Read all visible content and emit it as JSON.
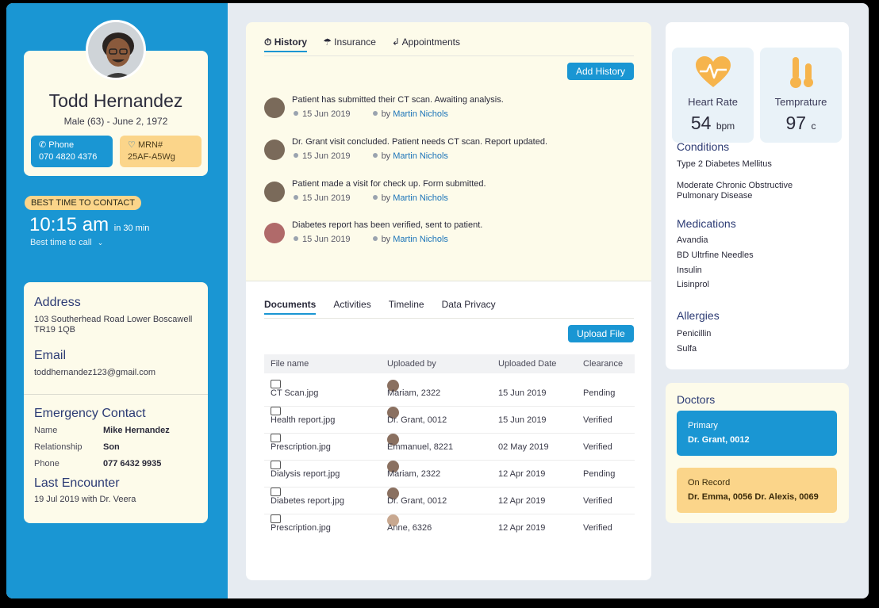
{
  "patient": {
    "name": "Todd Hernandez",
    "details": "Male (63) - June 2, 1972",
    "phone_label": "Phone",
    "phone": "070 4820 4376",
    "mrn_label": "MRN#",
    "mrn": "25AF-A5Wg"
  },
  "contact_time": {
    "badge": "BEST TIME TO CONTACT",
    "time": "10:15 am",
    "relative": "in 30 min",
    "sub": "Best time to call"
  },
  "contact": {
    "address_title": "Address",
    "address": "103  Southerhead Road Lower Boscawell TR19 1QB",
    "email_title": "Email",
    "email": "toddhernandez123@gmail.com",
    "emergency_title": "Emergency Contact",
    "emergency": [
      {
        "key": "Name",
        "value": "Mike Hernandez"
      },
      {
        "key": "Relationship",
        "value": "Son"
      },
      {
        "key": "Phone",
        "value": "077 6432 9935"
      }
    ],
    "last_encounter_title": "Last Encounter",
    "last_encounter": "19 Jul 2019 with Dr. Veera"
  },
  "history": {
    "tabs": [
      "History",
      "Insurance",
      "Appointments"
    ],
    "add_button": "Add History",
    "by_label": "by",
    "items": [
      {
        "text": "Patient has submitted their CT scan. Awaiting analysis.",
        "date": "15 Jun 2019",
        "author": "Martin Nichols"
      },
      {
        "text": "Dr. Grant visit concluded. Patient needs CT scan. Report updated.",
        "date": "15 Jun 2019",
        "author": "Martin Nichols"
      },
      {
        "text": "Patient made a visit for check up. Form submitted.",
        "date": "15 Jun 2019",
        "author": "Martin Nichols"
      },
      {
        "text": "Diabetes report has been verified, sent to patient.",
        "date": "15 Jun 2019",
        "author": "Martin Nichols"
      }
    ]
  },
  "documents": {
    "tabs": [
      "Documents",
      "Activities",
      "Timeline",
      "Data Privacy"
    ],
    "upload_button": "Upload  File",
    "columns": [
      "File name",
      "Uploaded by",
      "Uploaded Date",
      "Clearance"
    ],
    "rows": [
      {
        "file": "CT Scan.jpg",
        "by": "Mariam, 2322",
        "date": "15 Jun 2019",
        "clearance": "Pending"
      },
      {
        "file": "Health report.jpg",
        "by": "Dr. Grant, 0012",
        "date": "15 Jun 2019",
        "clearance": "Verified"
      },
      {
        "file": "Prescription.jpg",
        "by": "Emmanuel, 8221",
        "date": "02 May 2019",
        "clearance": "Verified"
      },
      {
        "file": "Dialysis report.jpg",
        "by": "Mariam, 2322",
        "date": "12 Apr 2019",
        "clearance": "Pending"
      },
      {
        "file": "Diabetes report.jpg",
        "by": "Dr. Grant, 0012",
        "date": "12 Apr 2019",
        "clearance": "Verified"
      },
      {
        "file": "Prescription.jpg",
        "by": "Anne, 6326",
        "date": "12 Apr 2019",
        "clearance": "Verified"
      }
    ]
  },
  "vitals": {
    "heart_rate_label": "Heart Rate",
    "heart_rate_value": "54",
    "heart_rate_unit": "bpm",
    "temperature_label": "Temprature",
    "temperature_value": "97",
    "temperature_unit": "c"
  },
  "conditions": {
    "title": "Conditions",
    "items": [
      "Type 2 Diabetes Mellitus",
      "Moderate Chronic Obstructive Pulmonary Disease"
    ]
  },
  "medications": {
    "title": "Medications",
    "items": [
      "Avandia",
      "BD Ultrfine Needles",
      "Insulin",
      "Lisinprol"
    ]
  },
  "allergies": {
    "title": "Allergies",
    "items": [
      "Penicillin",
      "Sulfa"
    ]
  },
  "doctors": {
    "title": "Doctors",
    "primary_label": "Primary",
    "primary": "Dr. Grant, 0012",
    "record_label": "On Record",
    "record": "Dr. Emma, 0056 Dr. Alexis, 0069"
  },
  "colors": {
    "accent_blue": "#1a96d3",
    "accent_yellow": "#fbd58a",
    "heading_navy": "#2c3b74",
    "heart_icon": "#f6b44c"
  }
}
